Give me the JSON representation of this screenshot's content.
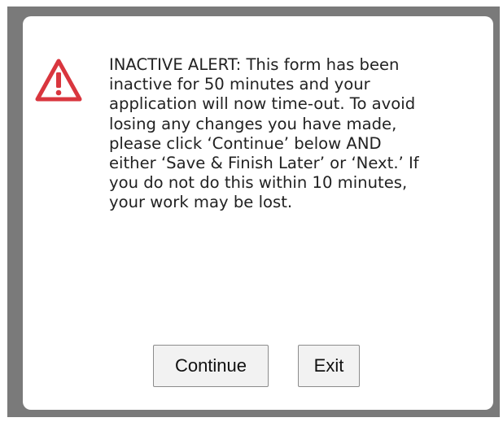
{
  "dialog": {
    "icon": "warning-triangle-icon",
    "accent_color": "#d9363e",
    "message": "INACTIVE ALERT: This form has been inactive for 50 minutes and your application will now time-out. To avoid losing any changes you have made, please click ‘Continue’ below AND either ‘Save & Finish Later’ or ‘Next.’ If you do not do this within 10 minutes, your work may be lost.",
    "buttons": {
      "continue_label": "Continue",
      "exit_label": "Exit"
    }
  }
}
